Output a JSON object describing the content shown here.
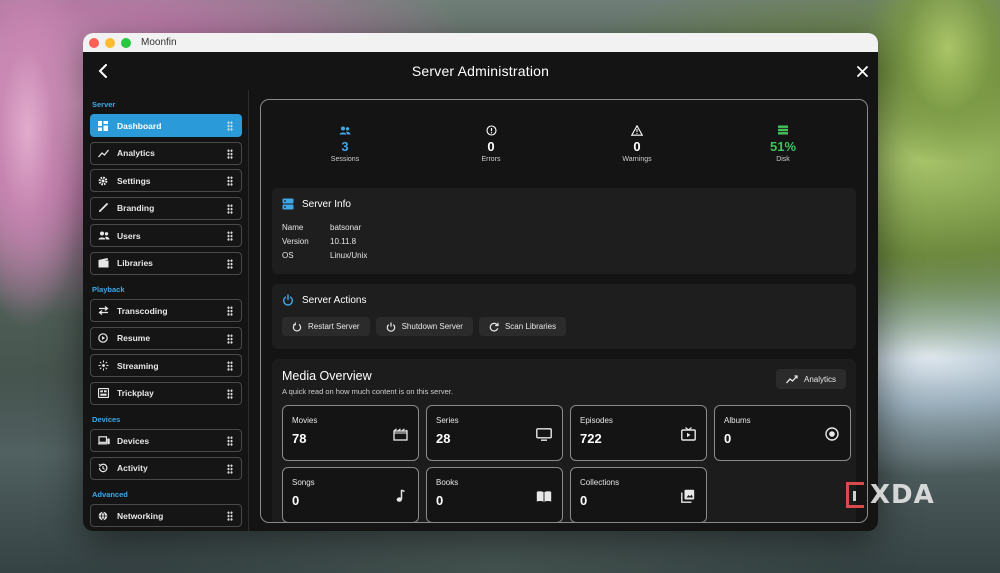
{
  "window": {
    "app_title": "Moonfin"
  },
  "header": {
    "title": "Server Administration"
  },
  "sidebar": {
    "sections": [
      {
        "label": "Server",
        "items": [
          {
            "label": "Dashboard",
            "icon": "dashboard-icon",
            "active": true
          },
          {
            "label": "Analytics",
            "icon": "analytics-icon"
          },
          {
            "label": "Settings",
            "icon": "gear-icon"
          },
          {
            "label": "Branding",
            "icon": "brush-icon"
          },
          {
            "label": "Users",
            "icon": "users-icon"
          },
          {
            "label": "Libraries",
            "icon": "film-icon"
          }
        ]
      },
      {
        "label": "Playback",
        "items": [
          {
            "label": "Transcoding",
            "icon": "transcode-icon"
          },
          {
            "label": "Resume",
            "icon": "play-circle-icon"
          },
          {
            "label": "Streaming",
            "icon": "streaming-icon"
          },
          {
            "label": "Trickplay",
            "icon": "trickplay-icon"
          }
        ]
      },
      {
        "label": "Devices",
        "items": [
          {
            "label": "Devices",
            "icon": "devices-icon"
          },
          {
            "label": "Activity",
            "icon": "history-icon"
          }
        ]
      },
      {
        "label": "Advanced",
        "items": [
          {
            "label": "Networking",
            "icon": "globe-icon"
          }
        ]
      }
    ]
  },
  "stats": [
    {
      "value": "3",
      "label": "Sessions",
      "icon": "users-icon",
      "color": "#3fa7e6"
    },
    {
      "value": "0",
      "label": "Errors",
      "icon": "error-icon",
      "color": "#ffffff"
    },
    {
      "value": "0",
      "label": "Warnings",
      "icon": "warning-icon",
      "color": "#ffffff"
    },
    {
      "value": "51%",
      "label": "Disk",
      "icon": "storage-icon",
      "color": "#3fc45a"
    }
  ],
  "server_info": {
    "title": "Server Info",
    "rows": [
      {
        "key": "Name",
        "value": "batsonar"
      },
      {
        "key": "Version",
        "value": "10.11.8"
      },
      {
        "key": "OS",
        "value": "Linux/Unix"
      }
    ]
  },
  "server_actions": {
    "title": "Server Actions",
    "buttons": [
      {
        "label": "Restart Server",
        "icon": "restart-icon"
      },
      {
        "label": "Shutdown Server",
        "icon": "power-icon"
      },
      {
        "label": "Scan Libraries",
        "icon": "refresh-icon"
      }
    ]
  },
  "media_overview": {
    "title": "Media Overview",
    "subtitle": "A quick read on how much content is on this server.",
    "analytics_label": "Analytics",
    "tiles": [
      {
        "label": "Movies",
        "value": "78",
        "icon": "movie-icon"
      },
      {
        "label": "Series",
        "value": "28",
        "icon": "tv-icon"
      },
      {
        "label": "Episodes",
        "value": "722",
        "icon": "episode-icon"
      },
      {
        "label": "Albums",
        "value": "0",
        "icon": "album-icon"
      },
      {
        "label": "Songs",
        "value": "0",
        "icon": "music-note-icon"
      },
      {
        "label": "Books",
        "value": "0",
        "icon": "book-icon"
      },
      {
        "label": "Collections",
        "value": "0",
        "icon": "collections-icon"
      }
    ]
  },
  "watermark": {
    "text": "XDA"
  },
  "colors": {
    "accent": "#2a9bd8",
    "section_label": "#3fa7e6",
    "disk_green": "#3fc45a"
  }
}
